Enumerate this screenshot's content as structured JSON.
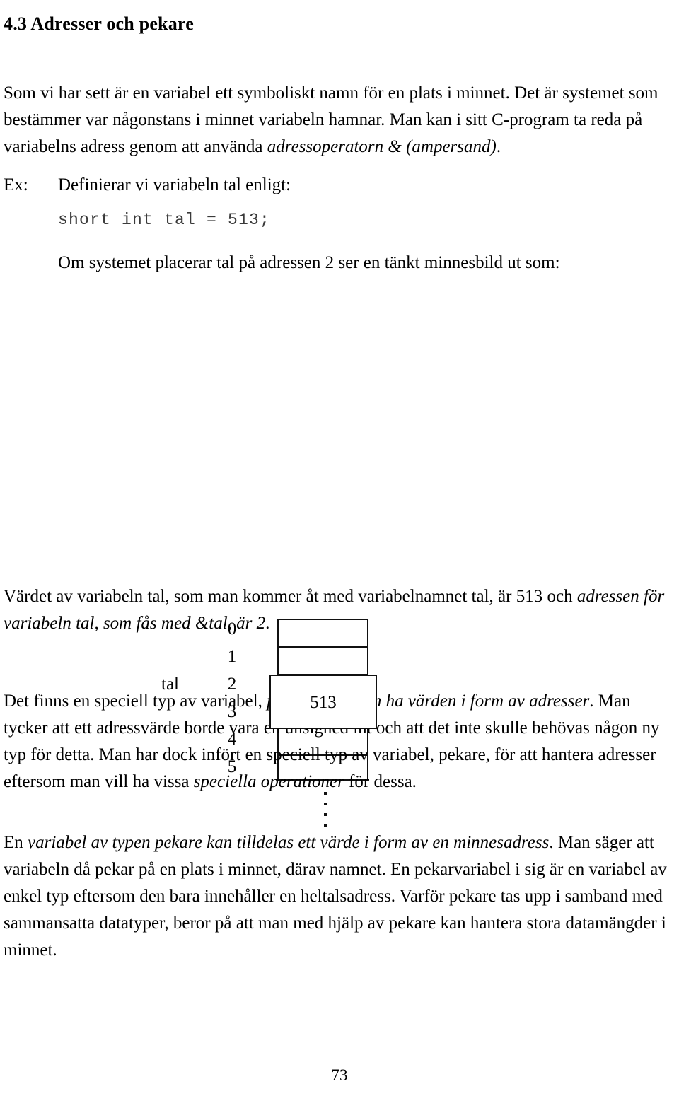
{
  "document": {
    "heading": "4.3 Adresser och pekare",
    "page_number": "73",
    "intro_paragraph": {
      "text_1": "Som vi har sett är en variabel ett symboliskt namn för en plats i minnet. Det är systemet som bestämmer var någonstans i minnet variabeln hamnar. Man kan i sitt C-program ta reda på variabelns adress genom att använda ",
      "italic_1": "adressoperatorn & (ampersand)",
      "text_2": "."
    },
    "example": {
      "label": "Ex:",
      "line_1": "Definierar vi variabeln tal enligt:",
      "code": "short int tal = 513;",
      "line_2": "Om systemet placerar tal på adressen 2  ser en tänkt minnesbild ut som:"
    },
    "diagram": {
      "variable_label": "tal",
      "addresses": [
        "0",
        "1",
        "2",
        "3",
        "4",
        "5"
      ],
      "stored_value": "513",
      "continuation": "vertical-ellipsis"
    },
    "after_diagram_paragraph": {
      "text_1": "Värdet av variabeln tal, som man kommer åt med variabelnamnet tal, är 513 och ",
      "italic_1": "adressen för variabeln tal, som fås med &tal, är 2",
      "text_2": "."
    },
    "pekare_paragraph": {
      "text_1": "Det finns en speciell typ av variabel, ",
      "italic_1": "pekare, som kan ha värden i form av adresser",
      "text_2": ". Man tycker att ett adressvärde borde vara en unsigned int och att det inte skulle behövas någon ny typ för detta. Man har dock infört en speciell typ av variabel, pekare, för att hantera adresser eftersom man vill ha vissa ",
      "italic_2": "speciella operationer",
      "text_3": " för dessa."
    },
    "last_paragraph": {
      "text_1": "En ",
      "italic_1": "variabel av typen pekare kan tilldelas ett värde i form av en minnesadress",
      "text_2": ". Man säger att variabeln då pekar på en plats i minnet, därav namnet. En pekarvariabel i sig är en variabel av enkel typ eftersom den bara innehåller en heltalsadress. Varför pekare tas upp i samband med sammansatta datatyper, beror på att man med hjälp av pekare kan hantera stora datamängder i minnet."
    }
  }
}
